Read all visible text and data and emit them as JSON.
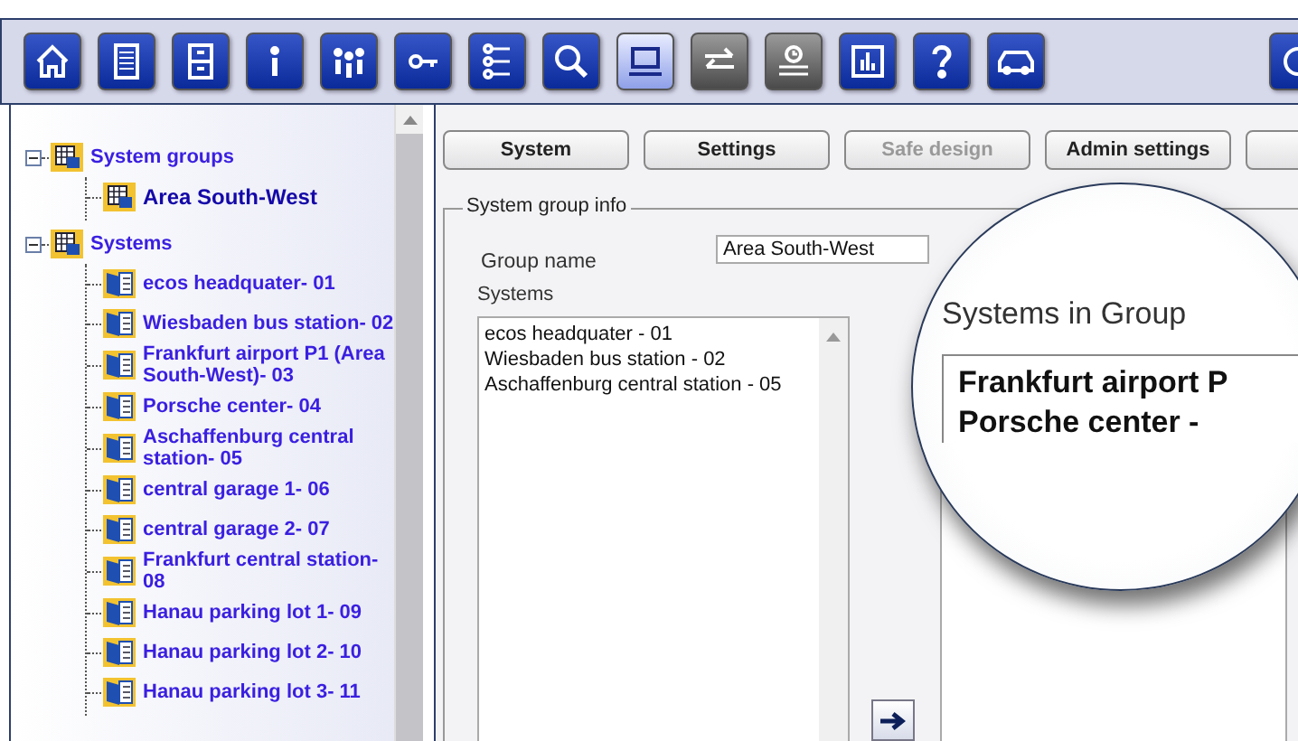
{
  "toolbar": {
    "buttons": [
      {
        "selected": false,
        "disabled": false
      },
      {
        "selected": false,
        "disabled": false
      },
      {
        "selected": false,
        "disabled": false
      },
      {
        "selected": false,
        "disabled": false
      },
      {
        "selected": false,
        "disabled": false
      },
      {
        "selected": false,
        "disabled": false
      },
      {
        "selected": false,
        "disabled": false
      },
      {
        "selected": false,
        "disabled": false
      },
      {
        "selected": true,
        "disabled": false
      },
      {
        "selected": false,
        "disabled": true
      },
      {
        "selected": false,
        "disabled": true
      },
      {
        "selected": false,
        "disabled": false
      },
      {
        "selected": false,
        "disabled": false
      },
      {
        "selected": false,
        "disabled": false
      },
      {
        "selected": false,
        "disabled": false
      }
    ]
  },
  "tree": [
    {
      "label": "System groups",
      "expanded": true,
      "selected": false,
      "children": [
        {
          "label": "Area South-West",
          "selected": true
        }
      ]
    },
    {
      "label": "Systems",
      "expanded": true,
      "selected": false,
      "children": [
        {
          "label": "ecos headquater- 01",
          "selected": false
        },
        {
          "label": "Wiesbaden bus station- 02",
          "selected": false
        },
        {
          "label": "Frankfurt airport P1 (Area South-West)- 03",
          "selected": false
        },
        {
          "label": "Porsche center- 04",
          "selected": false
        },
        {
          "label": "Aschaffenburg central station- 05",
          "selected": false
        },
        {
          "label": "central garage 1- 06",
          "selected": false
        },
        {
          "label": "central garage 2- 07",
          "selected": false
        },
        {
          "label": "Frankfurt central station- 08",
          "selected": false
        },
        {
          "label": "Hanau parking lot 1- 09",
          "selected": false
        },
        {
          "label": "Hanau parking lot 2- 10",
          "selected": false
        },
        {
          "label": "Hanau parking lot 3- 11",
          "selected": false
        }
      ]
    }
  ],
  "tabs": [
    {
      "label": "System",
      "disabled": false
    },
    {
      "label": "Settings",
      "disabled": false
    },
    {
      "label": "Safe design",
      "disabled": true
    },
    {
      "label": "Admin settings",
      "disabled": false
    }
  ],
  "group_info": {
    "title": "System group info",
    "group_name_label": "Group name",
    "group_name_value": "Area South-West",
    "systems_label": "Systems",
    "systems": [
      "ecos headquater - 01",
      "Wiesbaden bus station - 02",
      "Aschaffenburg central station - 05"
    ]
  },
  "magnifier": {
    "title": "Systems in Group",
    "items": [
      "Frankfurt airport P",
      "Porsche center -"
    ]
  }
}
